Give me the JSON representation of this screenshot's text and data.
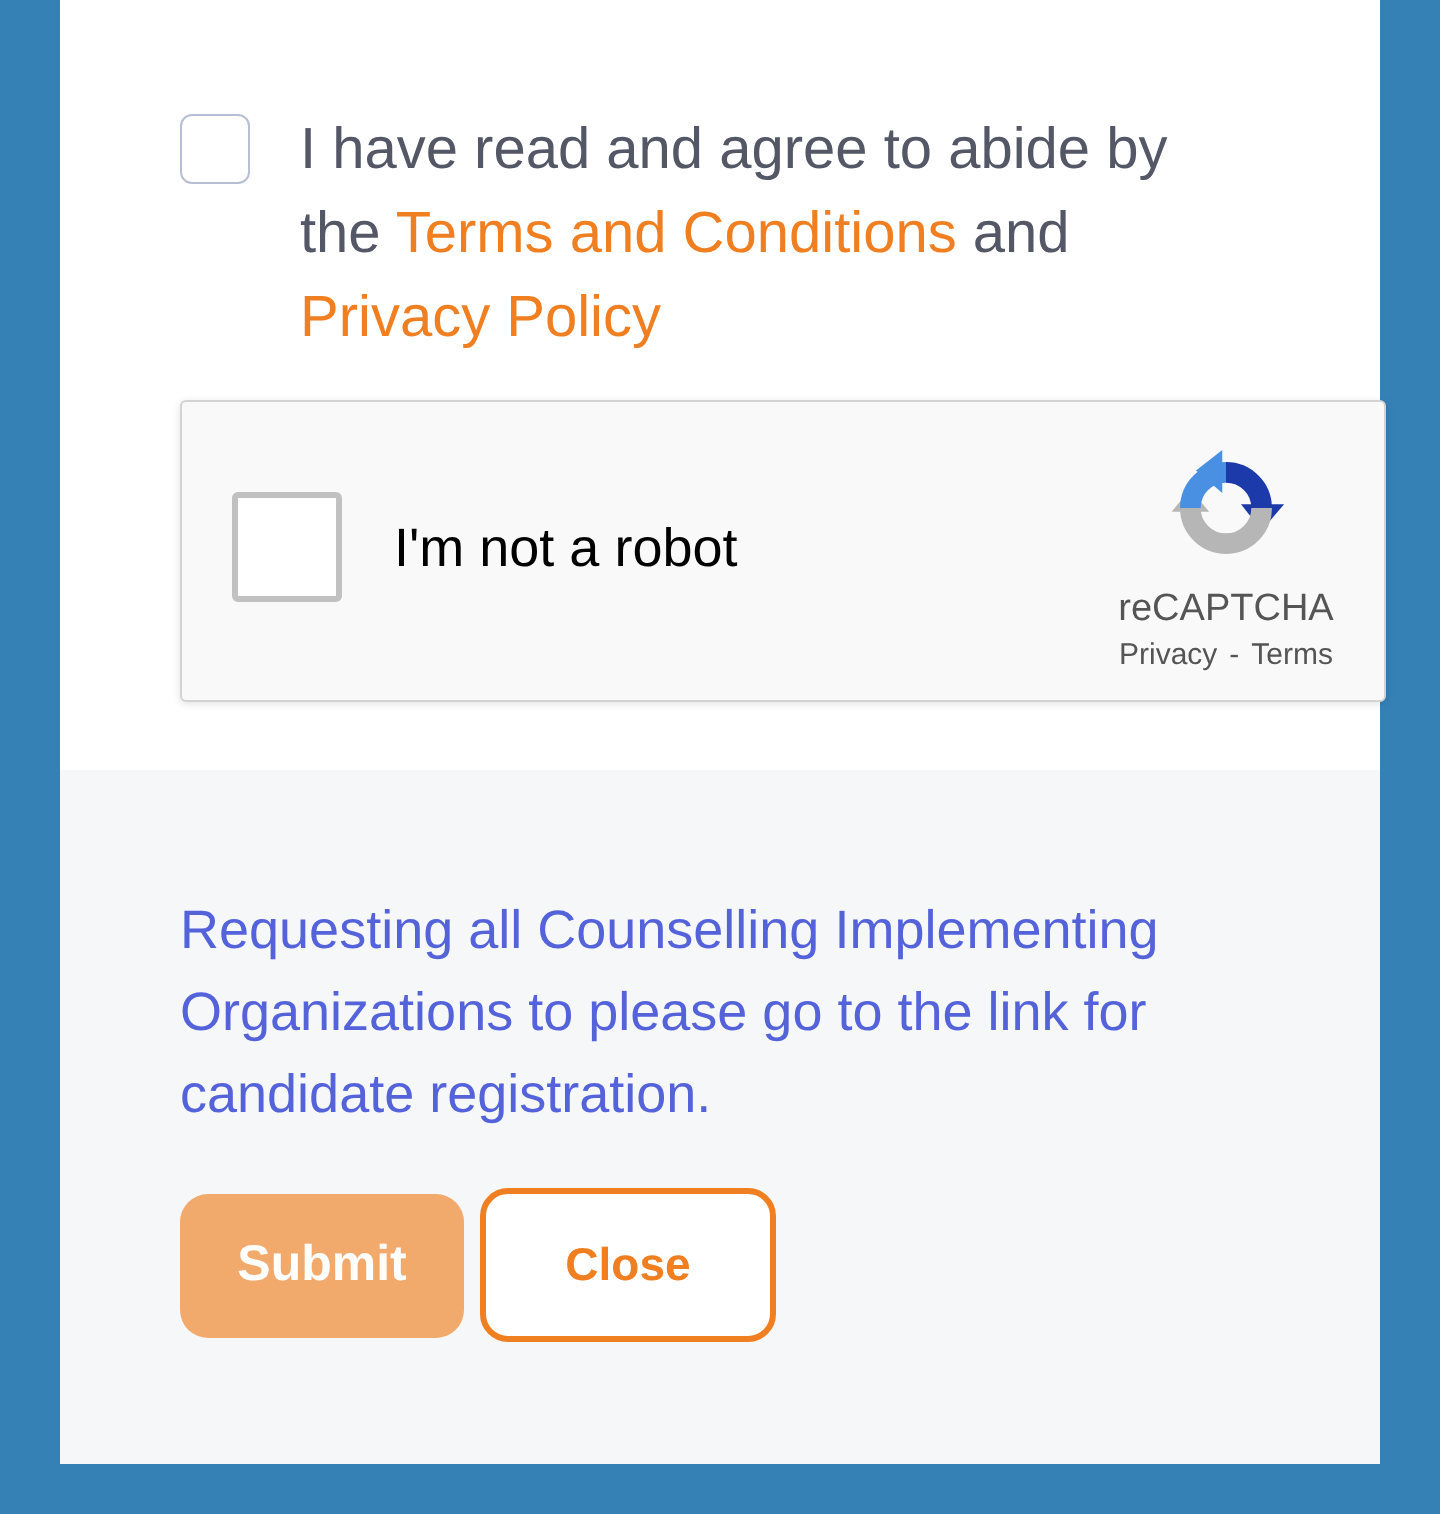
{
  "terms": {
    "checked": false,
    "parts": [
      {
        "kind": "text",
        "text": "I have read and agree to abide by the "
      },
      {
        "kind": "link",
        "text": "Terms and Conditions"
      },
      {
        "kind": "text",
        "text": " and "
      },
      {
        "kind": "link",
        "text": "Privacy Policy"
      }
    ]
  },
  "captcha": {
    "checked": false,
    "label": "I'm not a robot",
    "brand": "reCAPTCHA",
    "links": [
      "Privacy",
      "Terms"
    ],
    "separator": "-"
  },
  "notice": "Requesting all Counselling Implementing Organizations to please go to the link for candidate registration.",
  "buttons": [
    {
      "kind": "primary",
      "label": "Submit",
      "disabled": true
    },
    {
      "kind": "outline",
      "label": "Close",
      "disabled": false
    }
  ]
}
